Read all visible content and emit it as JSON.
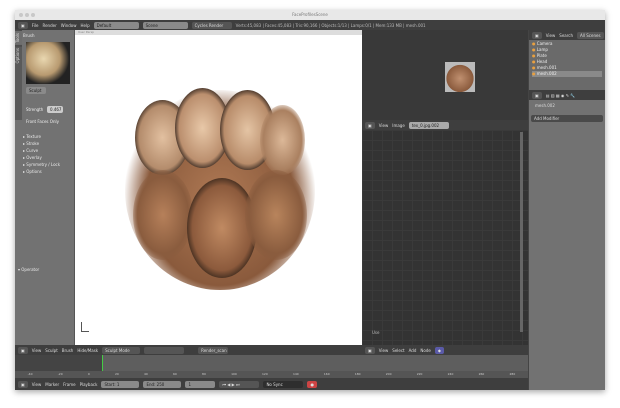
{
  "window": {
    "title": "FaceProfilesScene"
  },
  "info_header": {
    "menus": [
      "File",
      "Render",
      "Window",
      "Help"
    ],
    "layout": "Default",
    "scene": "Scene",
    "engine": "Cycles Render",
    "stats": "Verts:45,083 | Faces:45,083 | Tris:90,166 | Objects:1/13 | Lamps:0/1 | Mem:133 MB | mesh.001"
  },
  "tool_shelf": {
    "tabs": [
      "Tools",
      "Options"
    ],
    "brush_header": "Brush",
    "brush_name": "Sculpt",
    "strength_label": "Strength",
    "strength_value": "0.467",
    "front_faces_only": "Front Faces Only",
    "panels": [
      "Texture",
      "Stroke",
      "Curve",
      "Overlay",
      "Symmetry / Lock",
      "Options"
    ],
    "operator": "Operator"
  },
  "viewport": {
    "header_text": "User Persp",
    "footer_menus": [
      "View",
      "Sculpt",
      "Brush",
      "Hide/Mask"
    ],
    "mode": "Sculpt Mode",
    "render_layer": "Render_scan"
  },
  "image_editor": {
    "menus": [
      "View",
      "Image"
    ],
    "image_name": "tex_0.jpg.002",
    "node_menus": [
      "View",
      "Select",
      "Add",
      "Node"
    ],
    "use_label": "Use"
  },
  "outliner": {
    "menus": [
      "View",
      "Search"
    ],
    "display": "All Scenes",
    "items": [
      "Camera",
      "Lamp",
      "Plate",
      "Head",
      "mesh.001",
      "mesh.002"
    ]
  },
  "properties": {
    "object_name": "mesh.002",
    "add_modifier": "Add Modifier"
  },
  "timeline": {
    "menus": [
      "View",
      "Marker",
      "Frame",
      "Playback"
    ],
    "start_label": "Start:",
    "start": "1",
    "end_label": "End:",
    "end": "250",
    "current": "1",
    "sync": "No Sync",
    "ticks": [
      "-40",
      "-20",
      "0",
      "20",
      "40",
      "60",
      "80",
      "100",
      "120",
      "140",
      "160",
      "180",
      "200",
      "220",
      "240",
      "260",
      "280"
    ]
  }
}
